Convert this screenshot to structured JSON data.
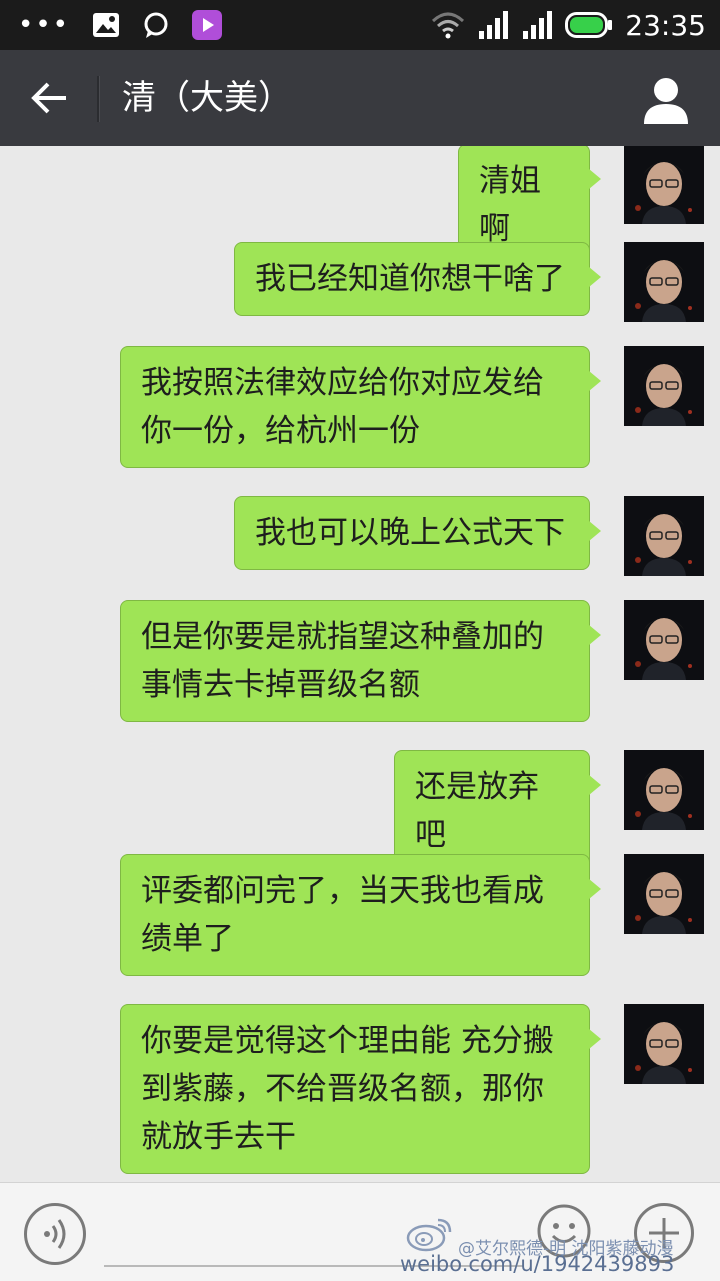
{
  "status_bar": {
    "time": "23:35",
    "icons": [
      "more-icon",
      "image-icon",
      "chat-bubble-icon",
      "video-icon",
      "wifi-icon",
      "signal-icon",
      "signal-icon",
      "battery-icon"
    ]
  },
  "header": {
    "title": "清（大美）",
    "back_icon": "arrow-left-icon",
    "contact_icon": "person-icon"
  },
  "messages": [
    {
      "text": "清姐啊"
    },
    {
      "text": "我已经知道你想干啥了"
    },
    {
      "text": "我按照法律效应给你对应发给你一份，给杭州一份"
    },
    {
      "text": "我也可以晚上公式天下"
    },
    {
      "text": "但是你要是就指望这种叠加的事情去卡掉晋级名额"
    },
    {
      "text": "还是放弃吧"
    },
    {
      "text": "评委都问完了，当天我也看成绩单了"
    },
    {
      "text": "你要是觉得这个理由能 充分搬到紫藤，不给晋级名额，那你就放手去干"
    }
  ],
  "input_bar": {
    "voice_icon": "voice-icon",
    "emoji_icon": "emoji-icon",
    "plus_icon": "plus-icon"
  },
  "watermark": {
    "line1": "@艾尔熙德-明 沈阳紫藤动漫",
    "line2": "weibo.com/u/1942439893"
  },
  "colors": {
    "bubble": "#9fe456",
    "titlebar": "#393a3f",
    "statusbar": "#1b1b1b",
    "chat_bg": "#e9e9e9"
  }
}
